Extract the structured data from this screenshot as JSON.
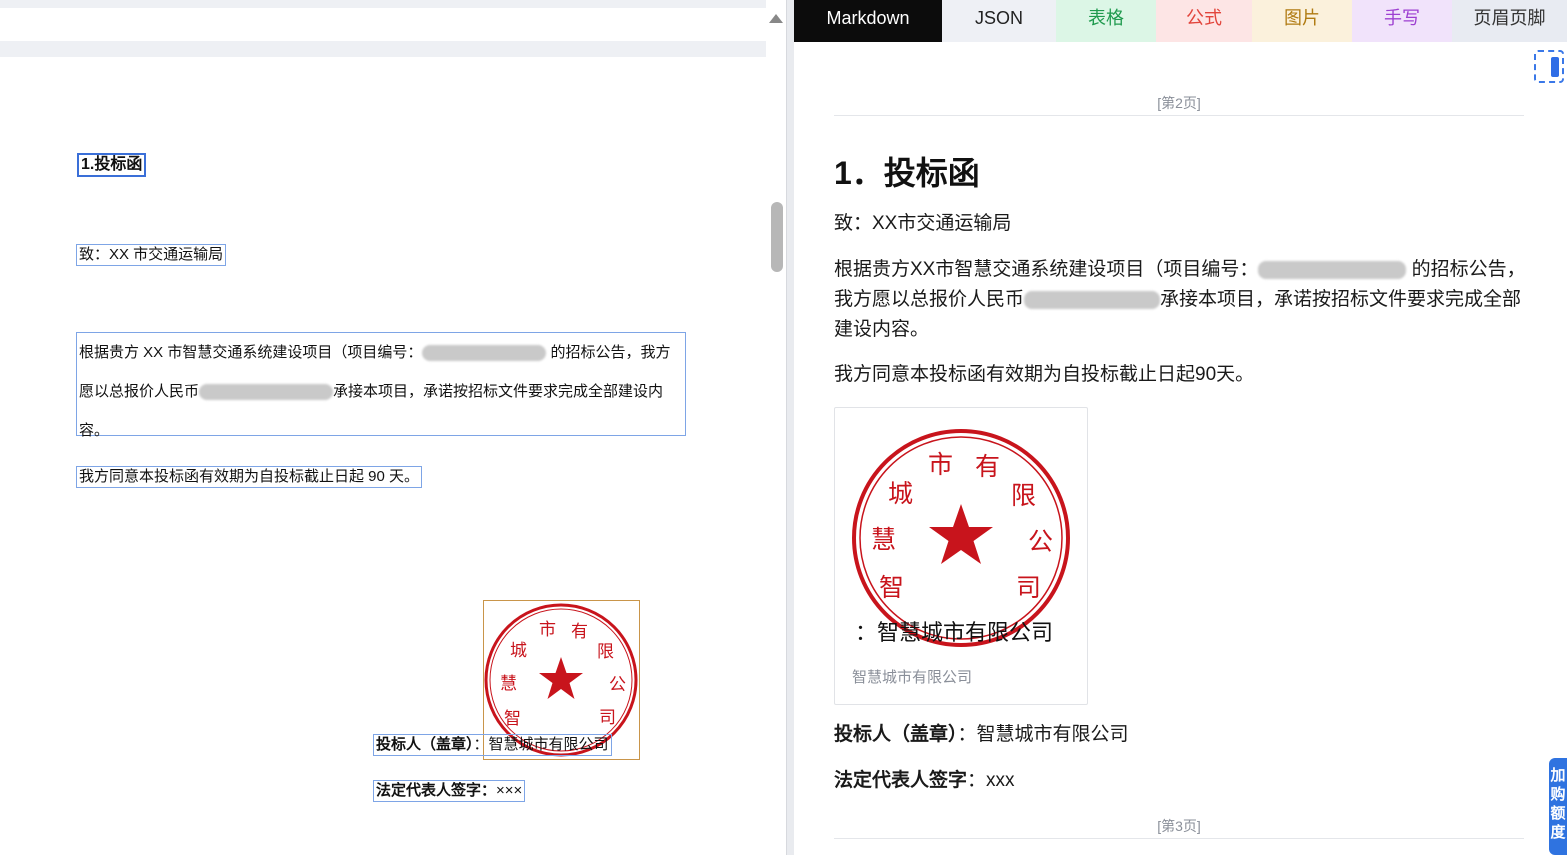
{
  "tabs": [
    {
      "label": "Markdown",
      "active": true
    },
    {
      "label": "JSON"
    },
    {
      "label": "表格"
    },
    {
      "label": "公式"
    },
    {
      "label": "图片"
    },
    {
      "label": "手写"
    },
    {
      "label": "页眉页脚"
    }
  ],
  "left_doc": {
    "heading": "1.投标函",
    "to": "致：XX 市交通运输局",
    "para1_a": "根据贵方 XX 市智慧交通系统建设项目（项目编号：",
    "para1_b": "的招标公告，我方愿以总报价人民币",
    "para1_c": "承接本项目，承诺按招标文件要求完成全部建设内容。",
    "para2": "我方同意本投标函有效期为自投标截止日起 90 天。",
    "bidder_label": "投标人（盖章）",
    "bidder_value": "：智慧城市有限公司",
    "rep_label": "法定代表人签字：",
    "rep_value": "×××"
  },
  "seal": {
    "text": "智慧城市有限公司",
    "color": "#c8141c"
  },
  "right_doc": {
    "page_mark_top": "[第2页]",
    "heading": "1．投标函",
    "to": "致：XX市交通运输局",
    "para1_a": "根据贵方XX市智慧交通系统建设项目（项目编号：",
    "para1_b": "的招标公告，我方愿以总报价人民币",
    "para1_c": "承接本项目，承诺按招标文件要求完成全部建设内容。",
    "para2": "我方同意本投标函有效期为自投标截止日起90天。",
    "image_text": "：智慧城市有限公司",
    "image_caption": "智慧城市有限公司",
    "bidder_label": "投标人（盖章）",
    "bidder_value": "：智慧城市有限公司",
    "rep_label": "法定代表人签字",
    "rep_value": "：xxx",
    "page_mark_bottom": "[第3页]"
  },
  "float_button": "加\n购\n额\n度"
}
